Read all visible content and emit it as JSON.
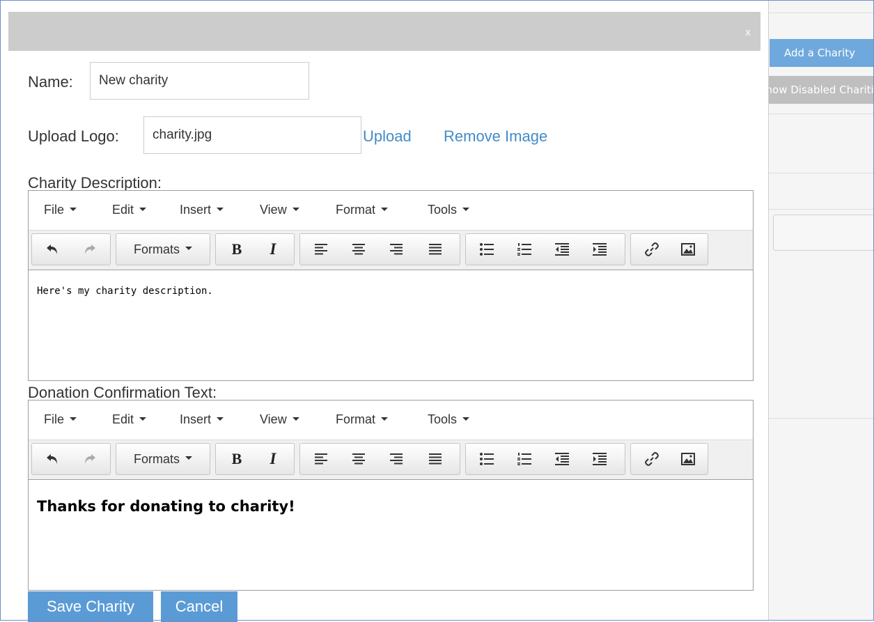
{
  "background": {
    "add_charity_label": "Add a Charity",
    "show_disabled_label": "Show Disabled Charities"
  },
  "modal": {
    "close_label": "x",
    "name": {
      "label": "Name:",
      "value": "New charity"
    },
    "logo": {
      "label": "Upload Logo:",
      "value": "charity.jpg",
      "upload_link": "Upload",
      "remove_link": "Remove Image"
    },
    "description": {
      "label": "Charity Description:",
      "menu": [
        "File",
        "Edit",
        "Insert",
        "View",
        "Format",
        "Tools"
      ],
      "formats_label": "Formats",
      "content": "Here's my charity description."
    },
    "confirmation": {
      "label": "Donation Confirmation Text:",
      "menu": [
        "File",
        "Edit",
        "Insert",
        "View",
        "Format",
        "Tools"
      ],
      "formats_label": "Formats",
      "content": "Thanks for donating to charity!"
    },
    "save_button": "Save Charity",
    "cancel_button": "Cancel"
  },
  "icons": [
    "undo-icon",
    "redo-icon",
    "bold-icon",
    "italic-icon",
    "align-left-icon",
    "align-center-icon",
    "align-right-icon",
    "align-justify-icon",
    "bullet-list-icon",
    "numbered-list-icon",
    "outdent-icon",
    "indent-icon",
    "link-icon",
    "image-icon"
  ],
  "colors": {
    "accent": "#5b9bd5",
    "link": "#428bca",
    "header": "#cccccc"
  }
}
